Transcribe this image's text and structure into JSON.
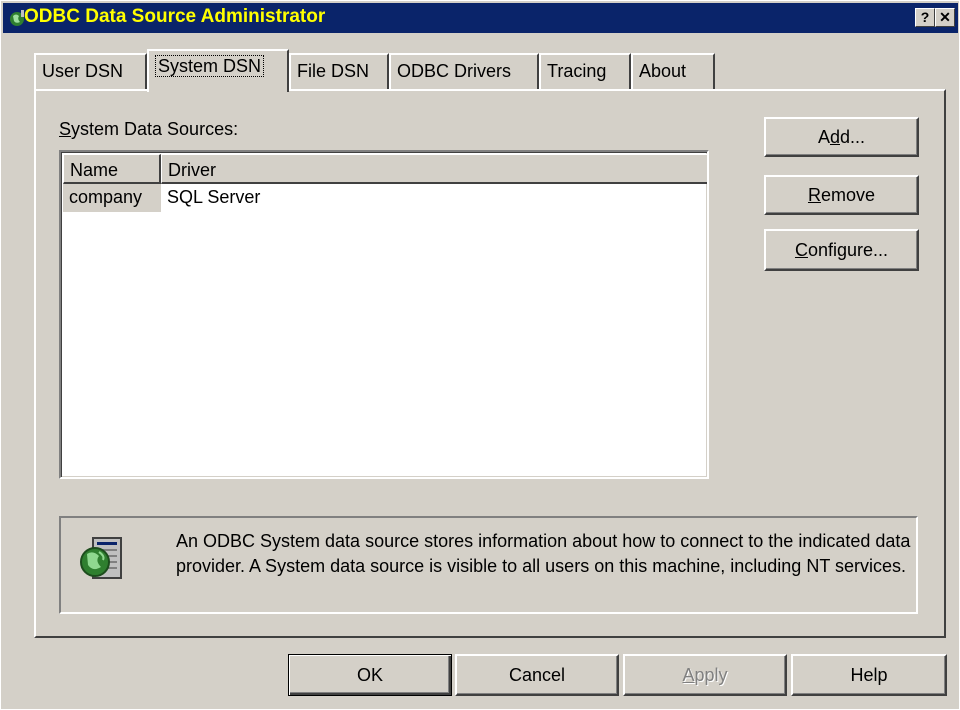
{
  "window": {
    "title": "ODBC Data Source Administrator",
    "help_button": "?",
    "close_button": "✕"
  },
  "tabs": [
    {
      "label": "User DSN",
      "active": false
    },
    {
      "label": "System DSN",
      "active": true
    },
    {
      "label": "File DSN",
      "active": false
    },
    {
      "label": "ODBC Drivers",
      "active": false
    },
    {
      "label": "Tracing",
      "active": false
    },
    {
      "label": "About",
      "active": false
    }
  ],
  "system_dsn": {
    "section_label_underlined": "S",
    "section_label_rest": "ystem Data Sources:",
    "columns": [
      "Name",
      "Driver"
    ],
    "rows": [
      {
        "name": "company",
        "driver": "SQL Server"
      }
    ],
    "buttons": {
      "add_pre": "A",
      "add_u": "d",
      "add_post": "d...",
      "remove_u": "R",
      "remove_post": "emove",
      "configure_u": "C",
      "configure_post": "onfigure..."
    },
    "info_text": "An ODBC System data source stores information about how to connect to the indicated data provider.  A System data source is visible to all users on this machine, including NT services."
  },
  "footer_buttons": {
    "ok": "OK",
    "cancel": "Cancel",
    "apply_u": "A",
    "apply_post": "pply",
    "help": "Help"
  },
  "icons": [
    "globe-icon",
    "database-globe-icon"
  ],
  "colors": {
    "titlebar": "#0a246a",
    "title_text": "#ffff00",
    "face": "#d4d0c8"
  }
}
